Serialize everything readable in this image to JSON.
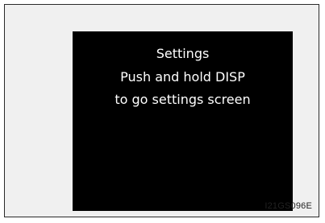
{
  "display": {
    "title": "Settings",
    "line2": "Push and hold DISP",
    "line3": "to go settings screen"
  },
  "figure_code": "I21GS096E",
  "colors": {
    "screen_background": "#000000",
    "text": "#ffffff",
    "frame_background": "#f0f0f0"
  }
}
